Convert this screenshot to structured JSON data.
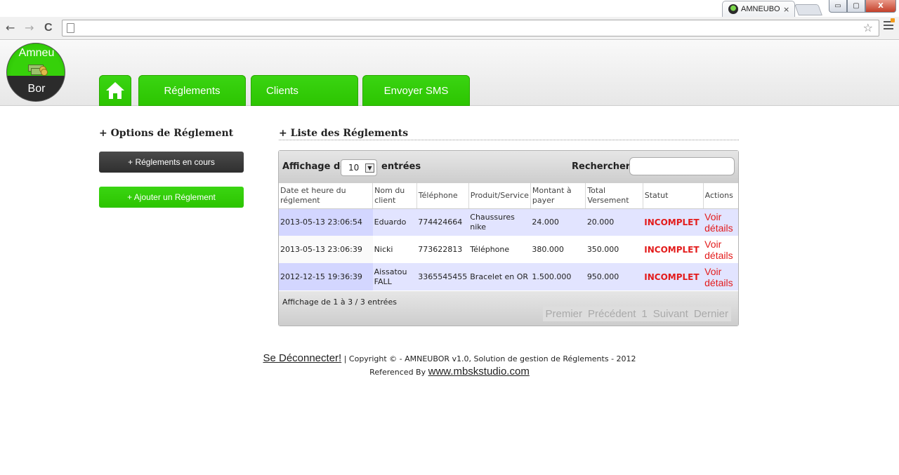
{
  "browser": {
    "tab_title": "AMNEUBOR",
    "tab_close": "×",
    "win_min": "▭",
    "win_max": "▢",
    "win_close": "X",
    "back": "←",
    "forward": "→",
    "reload": "C",
    "star": "☆"
  },
  "logo": {
    "line1": "Amneu",
    "line2": "Bor"
  },
  "nav": {
    "tab_reglements": "Réglements",
    "tab_clients": "Clients",
    "tab_sms": "Envoyer SMS"
  },
  "sidebar": {
    "title": "+ Options de Réglement",
    "btn_current": "+ Réglements en cours",
    "btn_add": "+ Ajouter un Réglement"
  },
  "main": {
    "title": "+ Liste des Réglements",
    "show_label": "Affichage de",
    "entries_label": "entrées",
    "page_size": "10",
    "search_label": "Rechercher:",
    "search_value": "",
    "columns": [
      "Date et heure du réglement",
      "Nom du client",
      "Téléphone",
      "Produit/Service",
      "Montant à payer",
      "Total Versement",
      "Statut",
      "Actions"
    ],
    "rows": [
      {
        "date": "2013-05-13 23:06:54",
        "name": "Eduardo",
        "phone": "774424664",
        "product": "Chaussures nike",
        "amount": "24.000",
        "paid": "20.000",
        "status": "INCOMPLET",
        "action": "Voir détails"
      },
      {
        "date": "2013-05-13 23:06:39",
        "name": "Nicki",
        "phone": "773622813",
        "product": "Téléphone",
        "amount": "380.000",
        "paid": "350.000",
        "status": "INCOMPLET",
        "action": "Voir détails"
      },
      {
        "date": "2012-12-15 19:36:39",
        "name": "Aissatou FALL",
        "phone": "3365545455",
        "product": "Bracelet en OR",
        "amount": "1.500.000",
        "paid": "950.000",
        "status": "INCOMPLET",
        "action": "Voir détails"
      }
    ],
    "info": "Affichage de 1 à 3 / 3 entrées",
    "pager": {
      "first": "Premier",
      "prev": "Précédent",
      "page": "1",
      "next": "Suivant",
      "last": "Dernier"
    }
  },
  "footer": {
    "logout": "Se Déconnecter!",
    "copyright": " | Copyright © - AMNEUBOR v1.0, Solution de gestion de Réglements - 2012",
    "referenced": "Referenced By ",
    "site": "www.mbskstudio.com"
  }
}
